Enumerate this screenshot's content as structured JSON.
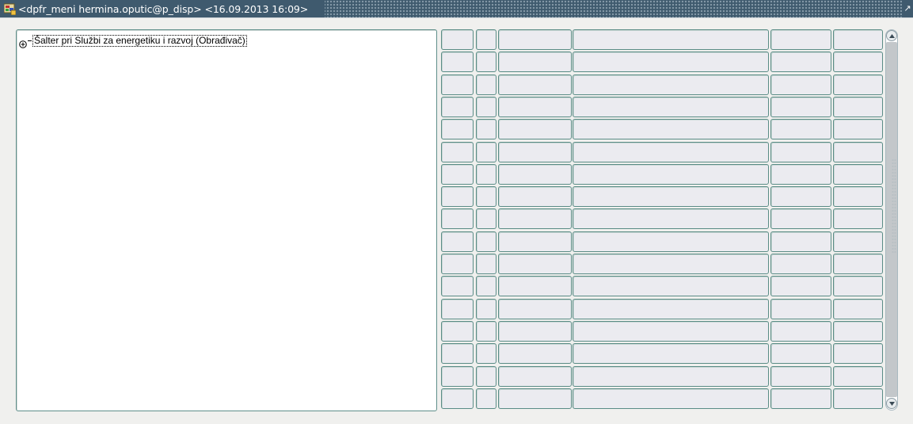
{
  "window": {
    "title": "<dpfr_meni hermina.oputic@p_disp> <16.09.2013 16:09>",
    "icon": "oracle-forms-app-icon",
    "maximize_glyph": "↗"
  },
  "tree": {
    "root_node": {
      "label": "Šalter pri Službi za energetiku i razvoj (Obrađivač)",
      "expanded": false,
      "expander_icon": "plus-box-icon"
    }
  },
  "grid": {
    "rows": 17,
    "columns": 6,
    "cells_empty": true
  },
  "scrollbar": {
    "up_icon": "scroll-up-icon",
    "down_icon": "scroll-down-icon"
  },
  "colors": {
    "titlebar": "#3f5a6e",
    "cell_border": "#5a8c86",
    "cell_fill": "#ebebf0",
    "background": "#f0f0ee"
  }
}
